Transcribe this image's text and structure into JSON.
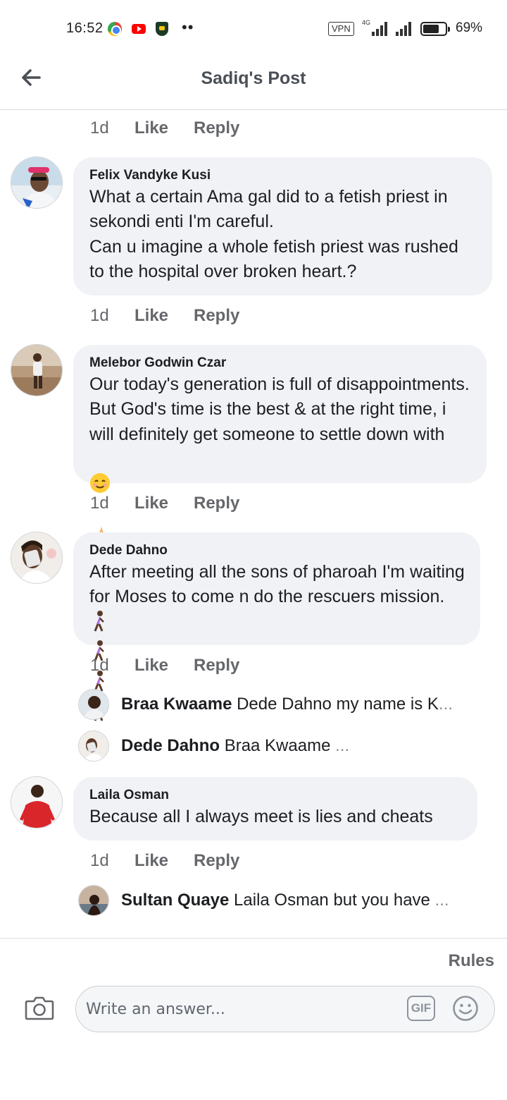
{
  "status_bar": {
    "time": "16:52",
    "dots": "••",
    "vpn": "VPN",
    "network": "4G",
    "battery_pct": "69%",
    "battery_level": 0.69,
    "app_icons": [
      "chrome-icon",
      "youtube-icon",
      "shield-app-icon"
    ]
  },
  "header": {
    "back_icon": "back-arrow-icon",
    "title": "Sadiq's Post"
  },
  "labels": {
    "like": "Like",
    "reply": "Reply"
  },
  "top_actions": {
    "age": "1d"
  },
  "comments": [
    {
      "author": "Felix Vandyke Kusi",
      "text": "What a certain Ama gal did to a fetish priest in sekondi enti I'm careful.\nCan u imagine a whole fetish priest was rushed to the hospital over broken heart.?",
      "age": "1d"
    },
    {
      "author": "Melebor Godwin Czar",
      "text": "Our today's generation is full of disappointments. But God's time is the best & at the right time, i will definitely get someone to settle down with",
      "emojis": [
        "smiling-face-emoji",
        "folded-hands-emoji"
      ],
      "age": "1d"
    },
    {
      "author": "Dede Dahno",
      "text": "After meeting all the sons of pharoah I'm waiting for Moses to come n do the rescuers mission.",
      "emojis": [
        "woman-walking-emoji",
        "woman-walking-emoji",
        "woman-walking-emoji",
        "woman-walking-emoji"
      ],
      "age": "1d",
      "replies": [
        {
          "author": "Braa Kwaame",
          "preview": "Dede Dahno my name is K",
          "more": "..."
        },
        {
          "author": "Dede Dahno",
          "preview": "Braa Kwaame",
          "more": "..."
        }
      ]
    },
    {
      "author": "Laila Osman",
      "text": "Because all I always meet is lies and cheats",
      "age": "1d",
      "replies": [
        {
          "author": "Sultan Quaye",
          "preview": "Laila Osman but you have",
          "more": "..."
        }
      ]
    }
  ],
  "composer": {
    "rules": "Rules",
    "placeholder": "Write an answer...",
    "gif": "GIF",
    "camera_icon": "camera-icon",
    "emoji_icon": "emoji-face-icon"
  }
}
